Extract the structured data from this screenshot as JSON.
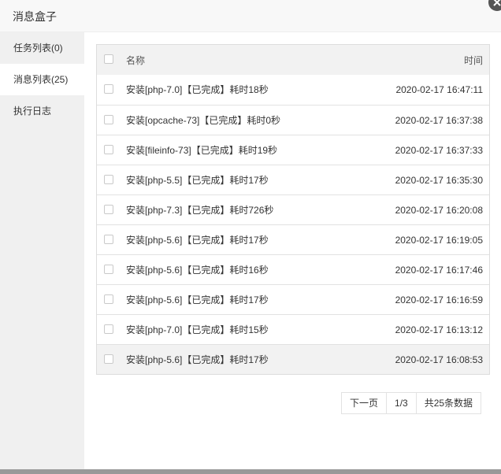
{
  "window": {
    "title": "消息盒子"
  },
  "sidebar": {
    "items": [
      {
        "label": "任务列表(0)"
      },
      {
        "label": "消息列表(25)"
      },
      {
        "label": "执行日志"
      }
    ]
  },
  "table": {
    "headers": {
      "name": "名称",
      "time": "时间"
    },
    "rows": [
      {
        "name": "安装[php-7.0]【已完成】耗时18秒",
        "time": "2020-02-17 16:47:11"
      },
      {
        "name": "安装[opcache-73]【已完成】耗时0秒",
        "time": "2020-02-17 16:37:38"
      },
      {
        "name": "安装[fileinfo-73]【已完成】耗时19秒",
        "time": "2020-02-17 16:37:33"
      },
      {
        "name": "安装[php-5.5]【已完成】耗时17秒",
        "time": "2020-02-17 16:35:30"
      },
      {
        "name": "安装[php-7.3]【已完成】耗时726秒",
        "time": "2020-02-17 16:20:08"
      },
      {
        "name": "安装[php-5.6]【已完成】耗时17秒",
        "time": "2020-02-17 16:19:05"
      },
      {
        "name": "安装[php-5.6]【已完成】耗时16秒",
        "time": "2020-02-17 16:17:46"
      },
      {
        "name": "安装[php-5.6]【已完成】耗时17秒",
        "time": "2020-02-17 16:16:59"
      },
      {
        "name": "安装[php-7.0]【已完成】耗时15秒",
        "time": "2020-02-17 16:13:12"
      },
      {
        "name": "安装[php-5.6]【已完成】耗时17秒",
        "time": "2020-02-17 16:08:53"
      }
    ]
  },
  "pagination": {
    "next_label": "下一页",
    "page_indicator": "1/3",
    "total_label": "共25条数据"
  }
}
